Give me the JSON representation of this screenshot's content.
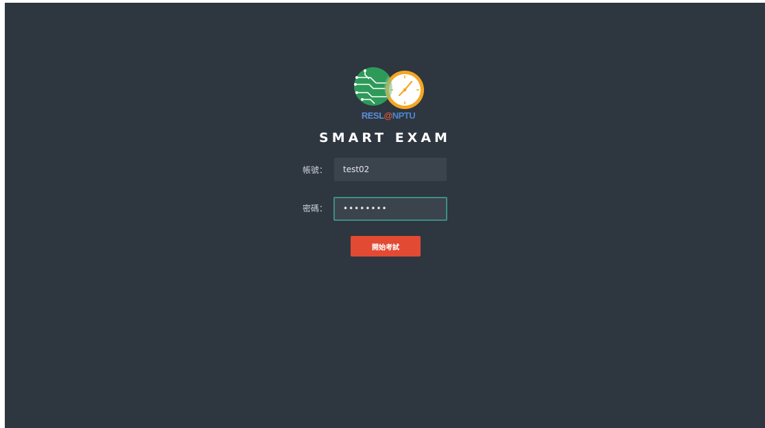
{
  "logo": {
    "text_part1": "RESL",
    "text_at": "@",
    "text_part2": "NPTU",
    "icon_left": "circuit-board-icon",
    "icon_right": "clock-icon"
  },
  "title": "SMART EXAM",
  "form": {
    "username_label": "帳號：",
    "username_value": "test02",
    "password_label": "密碼：",
    "password_value": "test0002",
    "submit_label": "開始考試"
  },
  "colors": {
    "background": "#2e3640",
    "field_background": "#3b434d",
    "focus_border": "#3e8e86",
    "button": "#e24a33"
  }
}
